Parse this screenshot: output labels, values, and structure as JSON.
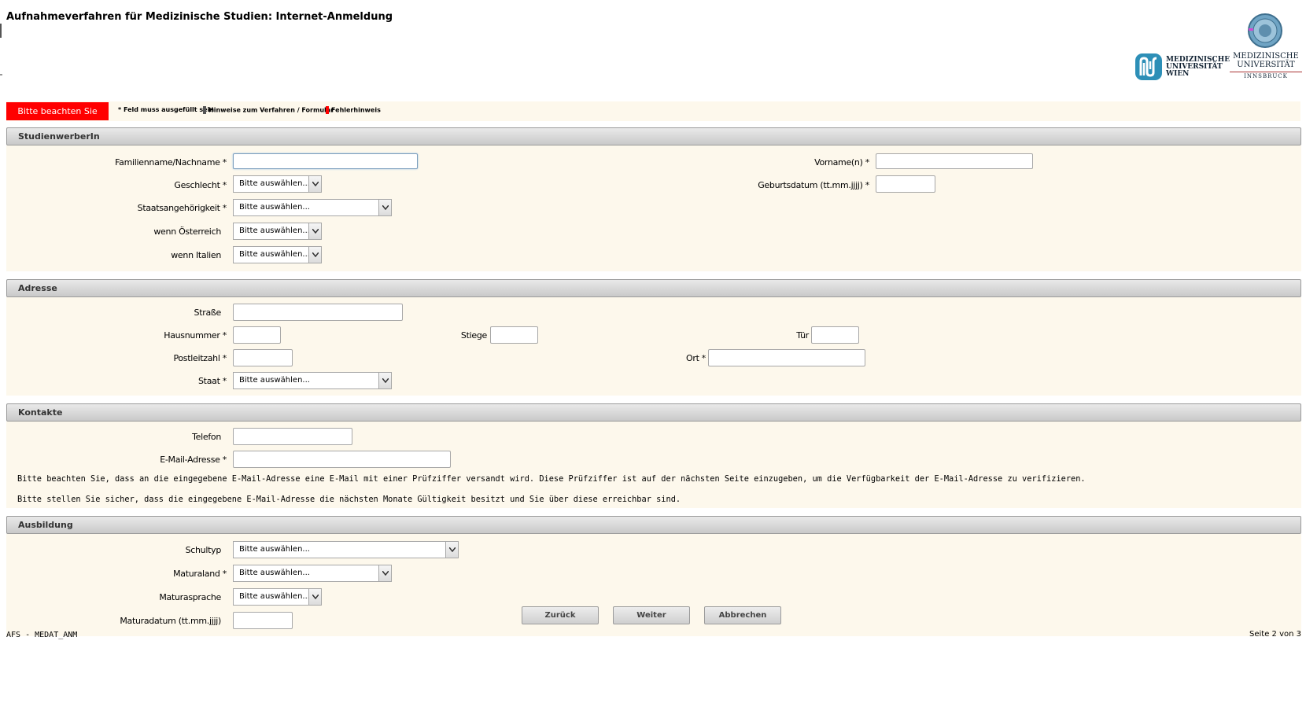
{
  "page": {
    "title": "Aufnahmeverfahren für Medizinische Studien: Internet-Anmeldung",
    "footer_left": "AFS - MEDAT_ANM",
    "footer_right": "Seite 2 von 3"
  },
  "logos": {
    "wien": [
      "MEDIZINISCHE",
      "UNIVERSITÄT",
      "WIEN"
    ],
    "innsbruck": [
      "MEDIZINISCHE",
      "UNIVERSITÄT",
      "INNSBRUCK"
    ]
  },
  "legend": {
    "notice": "Bitte beachten Sie",
    "required": "* Feld muss ausgefüllt sein",
    "hint": "Hinweise zum Verfahren / Formular",
    "error": "Fehlerhinweis",
    "colors": {
      "notice": "#ff0000",
      "hint": "#555555",
      "error": "#ff0000"
    }
  },
  "sections": {
    "studienwerber": {
      "title": "StudienwerberIn",
      "familienname": "Familienname/Nachname *",
      "vorname": "Vorname(n) *",
      "geschlecht": "Geschlecht *",
      "geburtsdatum": "Geburtsdatum (tt.mm.jjjj) *",
      "staatsangehoerigkeit": "Staatsangehörigkeit *",
      "oesterreich": "wenn Österreich",
      "italien": "wenn Italien"
    },
    "adresse": {
      "title": "Adresse",
      "strasse": "Straße",
      "hausnummer": "Hausnummer *",
      "stiege": "Stiege",
      "tuer": "Tür",
      "plz": "Postleitzahl *",
      "ort": "Ort *",
      "staat": "Staat *"
    },
    "kontakte": {
      "title": "Kontakte",
      "telefon": "Telefon",
      "email": "E-Mail-Adresse *",
      "note1": "Bitte beachten Sie, dass an die eingegebene E-Mail-Adresse eine E-Mail mit einer Prüfziffer versandt wird. Diese Prüfziffer ist auf der nächsten Seite einzugeben, um die Verfügbarkeit der E-Mail-Adresse zu verifizieren.",
      "note2": "Bitte stellen Sie sicher, dass die eingegebene E-Mail-Adresse die nächsten Monate Gültigkeit besitzt und Sie über diese erreichbar sind."
    },
    "ausbildung": {
      "title": "Ausbildung",
      "schultyp": "Schultyp",
      "maturaland": "Maturaland *",
      "maturasprache": "Maturasprache",
      "maturadatum": "Maturadatum (tt.mm.jjjj)"
    }
  },
  "select_placeholder": "Bitte auswählen...",
  "buttons": {
    "back": "Zurück",
    "next": "Weiter",
    "cancel": "Abbrechen"
  }
}
